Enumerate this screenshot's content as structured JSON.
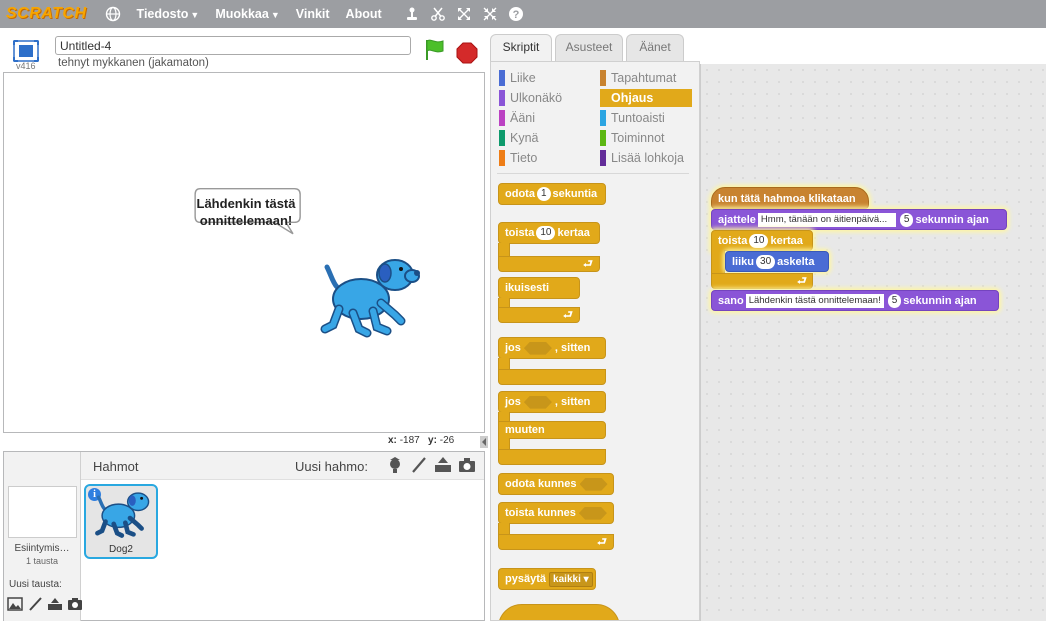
{
  "menubar": {
    "logo": "SCRATCH",
    "items": [
      {
        "label": "Tiedosto",
        "has_caret": true
      },
      {
        "label": "Muokkaa",
        "has_caret": true
      },
      {
        "label": "Vinkit",
        "has_caret": false
      },
      {
        "label": "About",
        "has_caret": false
      }
    ],
    "tools": [
      "duplicate-icon",
      "cut-icon",
      "grow-icon",
      "shrink-icon",
      "help-icon"
    ]
  },
  "stage_header": {
    "project_title": "Untitled-4",
    "byline": "tehnyt mykkanen (jakamaton)",
    "version": "v416"
  },
  "stage": {
    "speech_bubble": "Lähdenkin tästä onnittelemaan!",
    "coords": {
      "x_label": "x:",
      "x": "-187",
      "y_label": "y:",
      "y": "-26"
    }
  },
  "sprite_pane": {
    "title": "Hahmot",
    "new_sprite_label": "Uusi hahmo:",
    "stage_name": "Esiintymis…",
    "stage_count": "1 tausta",
    "new_backdrop_label": "Uusi tausta:",
    "sprites": [
      {
        "name": "Dog2",
        "selected": true
      }
    ]
  },
  "tabs": [
    {
      "label": "Skriptit",
      "active": true
    },
    {
      "label": "Asusteet",
      "active": false
    },
    {
      "label": "Äänet",
      "active": false
    }
  ],
  "categories": [
    {
      "label": "Liike",
      "color": "#4a6cd4"
    },
    {
      "label": "Ulkonäkö",
      "color": "#8a55d7"
    },
    {
      "label": "Ääni",
      "color": "#bb42c3"
    },
    {
      "label": "Kynä",
      "color": "#0e9a6c"
    },
    {
      "label": "Tieto",
      "color": "#ee7d16"
    },
    {
      "label": "Tapahtumat",
      "color": "#c88330"
    },
    {
      "label": "Ohjaus",
      "color": "#e1a91a",
      "selected": true
    },
    {
      "label": "Tuntoaisti",
      "color": "#2ca5e2"
    },
    {
      "label": "Toiminnot",
      "color": "#5cb712"
    },
    {
      "label": "Lisää lohkoja",
      "color": "#632d99"
    }
  ],
  "palette_blocks": {
    "wait": {
      "pre": "odota",
      "num": "1",
      "post": "sekuntia"
    },
    "repeat": {
      "pre": "toista",
      "num": "10",
      "post": "kertaa"
    },
    "forever": "ikuisesti",
    "if_then": {
      "pre": "jos",
      "post": ", sitten"
    },
    "if_else": {
      "pre": "jos",
      "post": ", sitten",
      "else": "muuten"
    },
    "wait_until": "odota kunnes",
    "repeat_until": "toista kunnes",
    "stop": {
      "label": "pysäytä",
      "option": "kaikki"
    }
  },
  "script": {
    "hat": "kun tätä hahmoa klikataan",
    "think": {
      "label": "ajattele",
      "text": "Hmm, tänään on äitienpäivä...",
      "num": "5",
      "post": "sekunnin ajan"
    },
    "repeat": {
      "label": "toista",
      "num": "10",
      "post": "kertaa"
    },
    "move": {
      "label": "liiku",
      "num": "30",
      "post": "askelta"
    },
    "say": {
      "label": "sano",
      "text": "Lähdenkin tästä onnittelemaan!",
      "num": "5",
      "post": "sekunnin ajan"
    }
  }
}
